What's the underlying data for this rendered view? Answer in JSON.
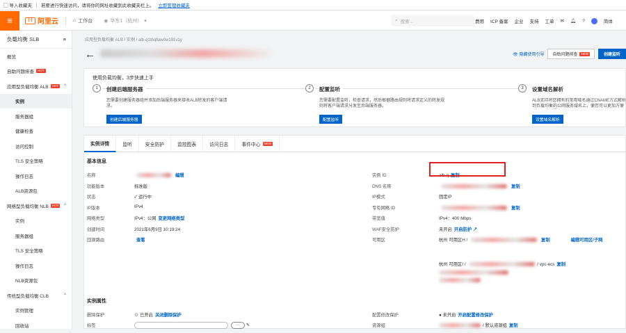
{
  "bookmark_bar": {
    "import": "导入收藏夹",
    "tip": "若要进行快速访问，请将你的网址收藏到此收藏夹栏上。",
    "manage_link": "立即管理收藏夹"
  },
  "topnav": {
    "logo": "阿里云",
    "workspace": "工作台",
    "region": "华东1（杭州）",
    "search_placeholder": "搜索...",
    "links": [
      "费用",
      "ICP 备案",
      "企业",
      "支持",
      "工单"
    ],
    "lang": "简体"
  },
  "sidebar": {
    "title": "负载均衡 SLB",
    "items": [
      {
        "label": "概览",
        "sub": false
      },
      {
        "label": "自助问题排查",
        "sub": false,
        "badge": "HOT"
      },
      {
        "label": "应用型负载均衡 ALB",
        "sub": false,
        "badge": "HOT",
        "chevron": "^"
      },
      {
        "label": "实例",
        "sub": true,
        "active": true
      },
      {
        "label": "服务器组",
        "sub": true
      },
      {
        "label": "健康检查",
        "sub": true
      },
      {
        "label": "访问控制",
        "sub": true
      },
      {
        "label": "TLS 安全策略",
        "sub": true
      },
      {
        "label": "操作日志",
        "sub": true
      },
      {
        "label": "ALB资源包",
        "sub": true
      },
      {
        "label": "网络型负载均衡 NLB",
        "sub": false,
        "badge": "HOT",
        "chevron": "^"
      },
      {
        "label": "实例",
        "sub": true
      },
      {
        "label": "服务器组",
        "sub": true
      },
      {
        "label": "TLS 安全策略",
        "sub": true
      },
      {
        "label": "操作日志",
        "sub": true
      },
      {
        "label": "NLB资源包",
        "sub": true
      },
      {
        "label": "传统型负载均衡 CLB",
        "sub": false,
        "chevron": "^"
      },
      {
        "label": "实例管理",
        "sub": true
      },
      {
        "label": "回收站",
        "sub": true
      }
    ]
  },
  "main": {
    "breadcrumb": "应用型负载均衡 ALB / 实例 / alb-q1tbqflaw0w191v1y",
    "header": {
      "hide_guide": "隐藏使用引导",
      "troubleshoot": "自助问题排查",
      "troubleshoot_badge": "NEW",
      "create": "创建监听"
    },
    "guide": {
      "title": "使用负载均衡，3步快速上手",
      "steps": [
        {
          "num": "1",
          "title": "创建后端服务器",
          "desc": "您需要创建服务器组并添加后端服务器来接收ALB转发的客户端请求。",
          "button": "创建后端服务器"
        },
        {
          "num": "2",
          "title": "配置监听",
          "desc": "您需要配置监听，检查请求，然后根据路由规则将请求定义的转发规则将客户端请求分发至后端服务器。",
          "button": "配置监听"
        },
        {
          "num": "3",
          "title": "设置域名解析",
          "desc": "ALB支持将您拥有的常用域名通过CNAME方式解析到负载均衡的公网服务域名上，便您可以更加方便地访问后端服务。",
          "button": "设置域名解析"
        }
      ]
    },
    "tabs": [
      {
        "label": "实例详情",
        "active": true
      },
      {
        "label": "监听"
      },
      {
        "label": "安全防护"
      },
      {
        "label": "监控图表"
      },
      {
        "label": "访问日志"
      },
      {
        "label": "事件中心",
        "badge": "NEW"
      }
    ],
    "basic": {
      "title": "基本信息",
      "left": [
        {
          "label": "名称",
          "value": "",
          "link": "编辑"
        },
        {
          "label": "功能版本",
          "value": "标准版"
        },
        {
          "label": "状态",
          "value": "✓ 运行中"
        },
        {
          "label": "IP版本",
          "value": "IPv4"
        },
        {
          "label": "网络类型",
          "value": "IPv4：公网",
          "link": "变更网络类型"
        },
        {
          "label": "创建时间",
          "value": "2021年6月9日 10:19:24"
        },
        {
          "label": "回源路由",
          "value": "",
          "link": "查看"
        }
      ],
      "right": [
        {
          "label": "实例 ID",
          "value": "alb-q",
          "link": "复制"
        },
        {
          "label": "DNS 名称",
          "value": "",
          "link": "复制"
        },
        {
          "label": "IP模式",
          "value": "固定IP"
        },
        {
          "label": "专有网络 ID",
          "value": "",
          "link": "复制"
        },
        {
          "label": "带宽值",
          "value": "IPv4：400 Mbps"
        },
        {
          "label": "WAF安全防护",
          "value": "未开启",
          "link": "开启防护 ↗"
        },
        {
          "label": "可用区",
          "value": "杭州 可用区H / ",
          "link": "复制",
          "extra": "编辑可用区/子网"
        },
        {
          "label": "",
          "value": "杭州 可用区I / ",
          "link": "复制",
          "extra2": "/ vpc-ecs"
        }
      ]
    },
    "attr": {
      "title": "实例属性",
      "left": [
        {
          "label": "删除保护",
          "value": "☉ 已开启",
          "link": "关闭删除保护"
        },
        {
          "label": "标签",
          "value": ""
        }
      ],
      "right": [
        {
          "label": "配置修改保护",
          "value": "● 未开启",
          "link": "开启配置修改保护"
        },
        {
          "label": "资源组",
          "value": "/ 默认资源组",
          "link": "复制"
        }
      ]
    }
  }
}
